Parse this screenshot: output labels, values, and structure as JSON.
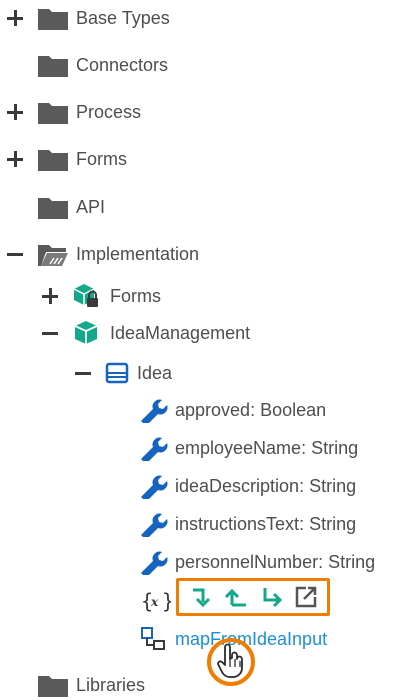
{
  "tree": {
    "base_types": "Base Types",
    "connectors": "Connectors",
    "process": "Process",
    "forms": "Forms",
    "api": "API",
    "implementation": "Implementation",
    "impl_forms": "Forms",
    "idea_management": "IdeaManagement",
    "idea": "Idea",
    "libraries": "Libraries",
    "properties": [
      {
        "name": "approved",
        "type": ": Boolean"
      },
      {
        "name": "employeeName",
        "type": ": String"
      },
      {
        "name": "ideaDescription",
        "type": ": String"
      },
      {
        "name": "instructionsText",
        "type": ": String"
      },
      {
        "name": "personnelNumber",
        "type": ": String"
      }
    ],
    "mapping_label": "mapFromIdeaInput"
  },
  "toolbar": {
    "buttons": [
      "arrow-down-right-icon",
      "arrow-up-icon",
      "arrow-right-down-icon",
      "open-external-icon"
    ]
  },
  "colors": {
    "folder": "#5a5a5a",
    "accent_teal": "#13a88a",
    "accent_blue": "#1565c0",
    "highlight_orange": "#ef7d00"
  }
}
